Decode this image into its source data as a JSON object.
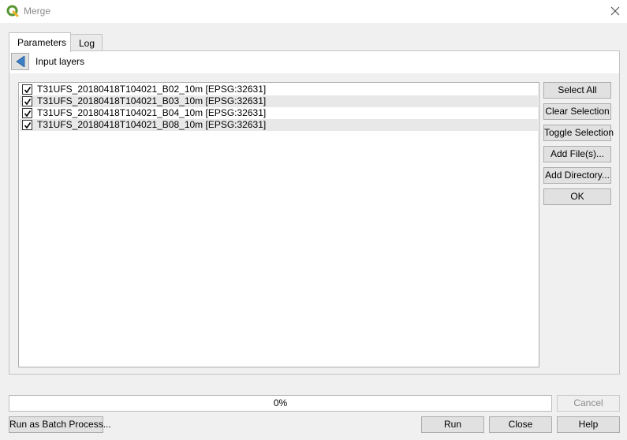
{
  "window": {
    "title": "Merge",
    "app_icon": "qgis-icon",
    "close_icon": "close-icon"
  },
  "tabs": [
    {
      "label": "Parameters",
      "active": true
    },
    {
      "label": "Log",
      "active": false
    }
  ],
  "header": {
    "back_icon": "back-arrow-icon",
    "label": "Input layers"
  },
  "layers": [
    {
      "label": "T31UFS_20180418T104021_B02_10m [EPSG:32631]",
      "checked": true
    },
    {
      "label": "T31UFS_20180418T104021_B03_10m [EPSG:32631]",
      "checked": true
    },
    {
      "label": "T31UFS_20180418T104021_B04_10m [EPSG:32631]",
      "checked": true
    },
    {
      "label": "T31UFS_20180418T104021_B08_10m [EPSG:32631]",
      "checked": true
    }
  ],
  "side_buttons": {
    "select_all": "Select All",
    "clear_selection": "Clear Selection",
    "toggle_selection": "Toggle Selection",
    "add_files": "Add File(s)...",
    "add_directory": "Add Directory...",
    "ok": "OK"
  },
  "progress": {
    "value": 0,
    "text": "0%"
  },
  "footer": {
    "cancel": "Cancel",
    "batch": "Run as Batch Process...",
    "run": "Run",
    "close": "Close",
    "help": "Help"
  },
  "colors": {
    "qgis_green": "#589632",
    "back_arrow_blue": "#3c7fc4"
  }
}
